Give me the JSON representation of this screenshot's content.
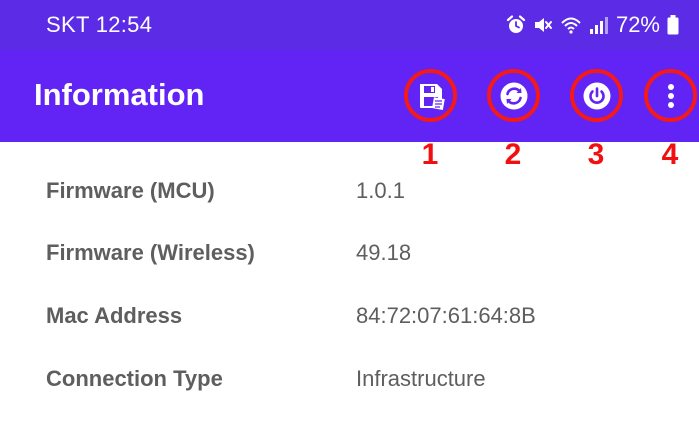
{
  "status_bar": {
    "carrier_time": "SKT 12:54",
    "battery": "72%",
    "icons": [
      "alarm-icon",
      "mute-icon",
      "wifi-icon",
      "signal-icon",
      "battery-icon"
    ]
  },
  "app_bar": {
    "title": "Information",
    "actions": [
      {
        "icon": "save-icon",
        "callout": "1"
      },
      {
        "icon": "refresh-icon",
        "callout": "2"
      },
      {
        "icon": "power-icon",
        "callout": "3"
      },
      {
        "icon": "more-vert-icon",
        "callout": "4"
      }
    ],
    "highlight_color": "#f41a1a"
  },
  "info": [
    {
      "label": "Firmware (MCU)",
      "value": "1.0.1"
    },
    {
      "label": "Firmware (Wireless)",
      "value": "49.18"
    },
    {
      "label": "Mac Address",
      "value": "84:72:07:61:64:8B"
    },
    {
      "label": "Connection Type",
      "value": "Infrastructure"
    }
  ],
  "colors": {
    "status_bar": "#5b2be6",
    "app_bar": "#6223f5",
    "text": "#5e5e5e"
  }
}
